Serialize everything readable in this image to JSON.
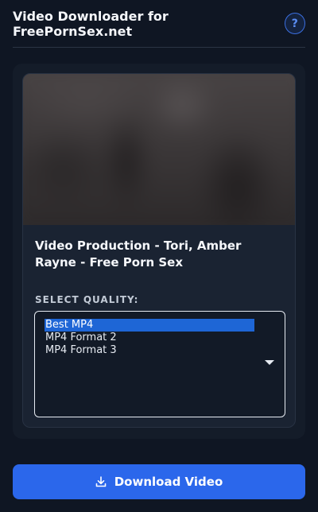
{
  "header": {
    "title": "Video Downloader for FreePornSex.net",
    "help_label": "?"
  },
  "video": {
    "title": "Video Production - Tori, Amber Rayne - Free Porn Sex"
  },
  "quality": {
    "label": "SELECT QUALITY:",
    "options": [
      "Best MP4",
      "MP4 Format 2",
      "MP4 Format 3"
    ],
    "selected": "Best MP4"
  },
  "download": {
    "label": "Download Video"
  },
  "colors": {
    "accent": "#2b67eb",
    "selection": "#1e66d6",
    "background": "#0f1623"
  },
  "icons": {
    "help": "question-icon",
    "download": "download-icon",
    "dropdown": "chevron-down-icon"
  }
}
